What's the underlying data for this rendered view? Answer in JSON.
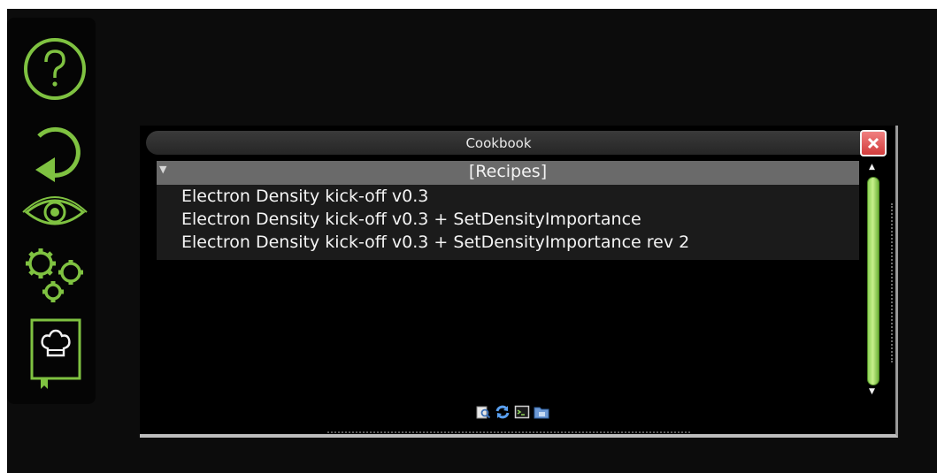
{
  "sidebar": {
    "tools": [
      {
        "name": "help",
        "icon": "question-circle-icon"
      },
      {
        "name": "undo",
        "icon": "rewind-arrow-icon"
      },
      {
        "name": "view",
        "icon": "eye-icon"
      },
      {
        "name": "settings",
        "icon": "gears-icon"
      },
      {
        "name": "cookbook",
        "icon": "chef-hat-book-icon"
      }
    ],
    "accent": "#7fc241"
  },
  "window": {
    "title": "Cookbook",
    "close_icon": "close-icon",
    "tree": {
      "header": "[Recipes]",
      "expanded_icon": "triangle-down-icon",
      "items": [
        {
          "label": "Electron Density kick-off v0.3"
        },
        {
          "label": "Electron Density kick-off v0.3 + SetDensityImportance"
        },
        {
          "label": "Electron Density kick-off v0.3 + SetDensityImportance rev 2"
        }
      ]
    },
    "scrollbar": {
      "up_arrow": "▲",
      "down_arrow": "▼",
      "thumb_color": "#9bdb5e"
    },
    "toolbar": [
      {
        "name": "inspect",
        "icon": "magnify-icon"
      },
      {
        "name": "refresh",
        "icon": "refresh-icon"
      },
      {
        "name": "script",
        "icon": "terminal-icon"
      },
      {
        "name": "folder",
        "icon": "folder-icon"
      }
    ]
  }
}
